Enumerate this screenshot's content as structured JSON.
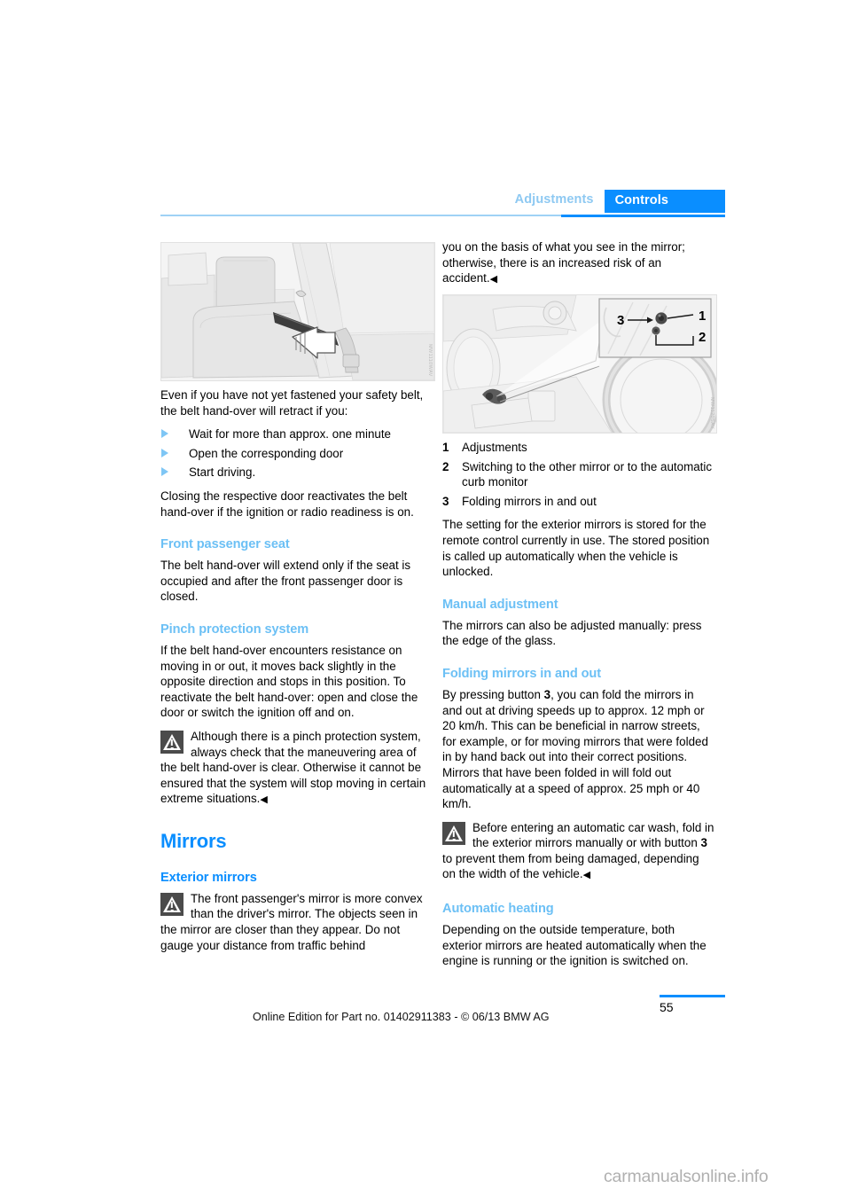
{
  "header": {
    "tab_inactive": "Adjustments",
    "tab_active": "Controls",
    "accent_color": "#0a8eff",
    "inactive_color": "#8ec9f2"
  },
  "figures": {
    "seat": {
      "alt": "Car seat with safety belt hand-over and white arrow indicating retract direction",
      "code": "MW1110WAV"
    },
    "dashboard": {
      "alt": "Driver door panel with exterior mirror control joystick, callout detail showing buttons 1, 2 and 3",
      "code": "MW1120SAV",
      "callout_labels": [
        "1",
        "2",
        "3"
      ]
    }
  },
  "left_column": {
    "intro_paragraph": "Even if you have not yet fastened your safety belt, the belt hand-over will retract if you:",
    "bullets": [
      "Wait for more than approx. one minute",
      "Open the corresponding door",
      "Start driving."
    ],
    "after_bullets": "Closing the respective door reactivates the belt hand-over if the ignition or radio readiness is on.",
    "front_passenger_seat": {
      "heading": "Front passenger seat",
      "paragraph": "The belt hand-over will extend only if the seat is occupied and after the front passenger door is closed."
    },
    "pinch_protection": {
      "heading": "Pinch protection system",
      "paragraph": "If the belt hand-over encounters resistance on moving in or out, it moves back slightly in the opposite direction and stops in this position. To reactivate the belt hand-over: open and close the door or switch the ignition off and on.",
      "warning": "Although there is a pinch protection system, always check that the maneuvering area of the belt hand-over is clear. Otherwise it cannot be ensured that the system will stop moving in certain extreme situations.",
      "end_mark": "◀"
    },
    "mirrors": {
      "chapter_heading": "Mirrors",
      "exterior_heading": "Exterior mirrors",
      "warning_part1": "The front passenger's mirror is more convex than the driver's mirror. The objects seen in the mirror are closer than they appear. Do not gauge your distance from traffic behind"
    }
  },
  "right_column": {
    "warning_continuation": "you on the basis of what you see in the mirror; otherwise, there is an increased risk of an accident.",
    "warning_end_mark": "◀",
    "legend": [
      {
        "num": "1",
        "text": "Adjustments"
      },
      {
        "num": "2",
        "text": "Switching to the other mirror or to the automatic curb monitor"
      },
      {
        "num": "3",
        "text": "Folding mirrors in and out"
      }
    ],
    "stored_setting_paragraph": "The setting for the exterior mirrors is stored for the remote control currently in use. The stored position is called up automatically when the vehicle is unlocked.",
    "manual_adjustment": {
      "heading": "Manual adjustment",
      "paragraph": "The mirrors can also be adjusted manually: press the edge of the glass."
    },
    "folding_mirrors": {
      "heading": "Folding mirrors in and out",
      "paragraph_pre": "By pressing button ",
      "button_num": "3",
      "paragraph_post": ", you can fold the mirrors in and out at driving speeds up to approx. 12 mph or 20 km/h. This can be beneficial in narrow streets, for example, or for moving mirrors that were folded in by hand back out into their correct positions. Mirrors that have been folded in will fold out automatically at a speed of approx. 25 mph or 40 km/h.",
      "warning_pre": "Before entering an automatic car wash, fold in the exterior mirrors manually or with button ",
      "warning_num": "3",
      "warning_post": " to prevent them from being damaged, depending on the width of the vehicle.",
      "end_mark": "◀"
    },
    "automatic_heating": {
      "heading": "Automatic heating",
      "paragraph": "Depending on the outside temperature, both exterior mirrors are heated automatically when the engine is running or the ignition is switched on."
    }
  },
  "footer": {
    "note": "Online Edition for Part no. 01402911383 - © 06/13 BMW AG",
    "page_number": "55",
    "watermark": "carmanualsonline.info"
  }
}
